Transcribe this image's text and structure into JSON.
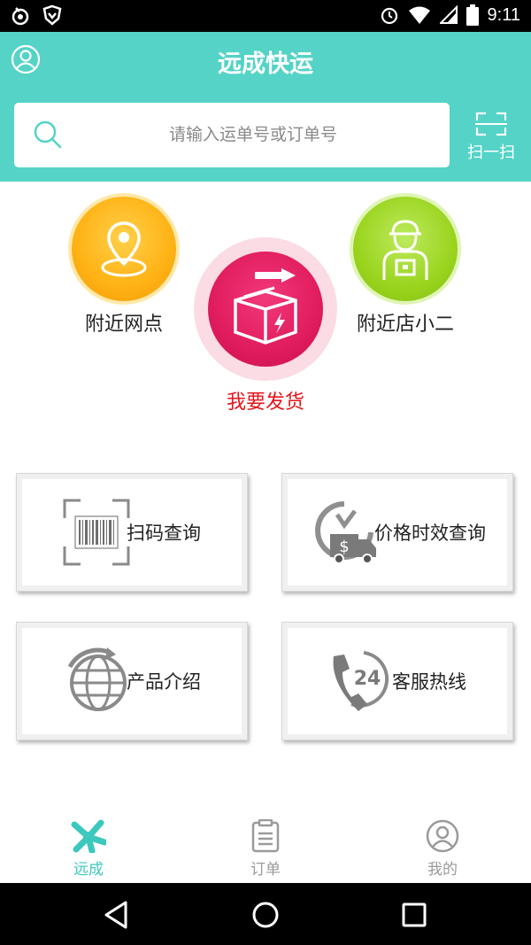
{
  "status_bar": {
    "time": "9:11",
    "icons": [
      "notification-icon",
      "shield-icon",
      "alarm-icon",
      "wifi-icon",
      "cell-signal-icon",
      "battery-icon"
    ]
  },
  "header": {
    "title": "远成快运",
    "search_placeholder": "请输入运单号或订单号",
    "scan_label": "扫一扫",
    "bg_color": "#55d3c6"
  },
  "quick_actions": {
    "nearby_outlets": "附近网点",
    "ship_now": "我要发货",
    "nearby_helper": "附近店小二"
  },
  "cards": {
    "scan_query": "扫码查询",
    "price_time_query": "价格时效查询",
    "product_intro": "产品介绍",
    "service_hotline": "客服热线"
  },
  "tabs": {
    "home": "远成",
    "orders": "订单",
    "mine": "我的",
    "active_color": "#3cc8bd"
  }
}
